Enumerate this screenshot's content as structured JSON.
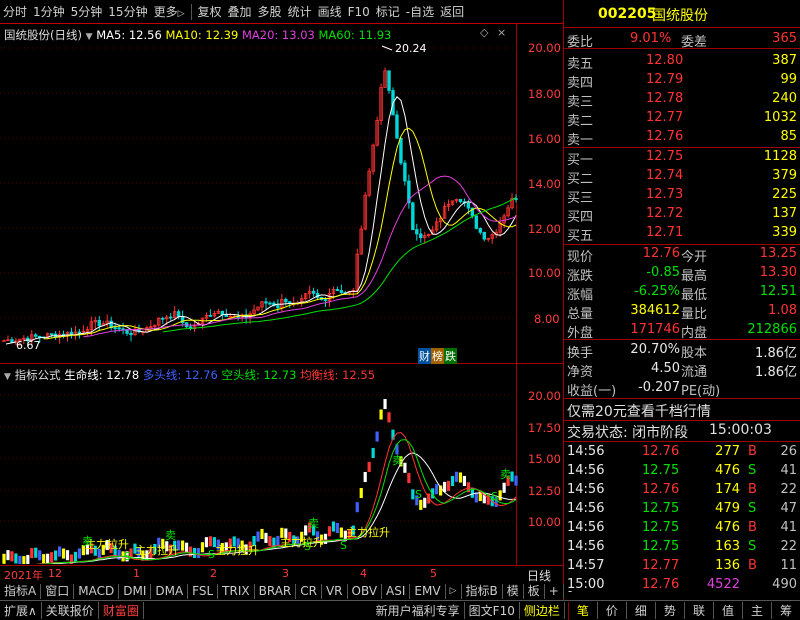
{
  "toolbar": {
    "items": [
      "分时",
      "1分钟",
      "5分钟",
      "15分钟",
      "更多",
      "复权",
      "叠加",
      "多股",
      "统计",
      "画线",
      "F10",
      "标记",
      "-自选",
      "返回"
    ],
    "more_arrow": "▷"
  },
  "stock": {
    "code": "002205",
    "name": "国统股份"
  },
  "main_chart": {
    "title": "国统股份(日线)",
    "ma5_label": "MA5: 12.56",
    "ma10_label": "MA10: 12.39",
    "ma20_label": "MA20: 13.03",
    "ma60_label": "MA60: 11.93",
    "high_label": "20.24",
    "low_label": "6.67",
    "price_ticks": [
      "20.00",
      "18.00",
      "16.00",
      "14.00",
      "12.00",
      "10.00",
      "8.00"
    ],
    "badges": [
      "财",
      "榜",
      "跌"
    ]
  },
  "indicator": {
    "title": "指标公式",
    "life_line": "生命线: 12.78",
    "long_line": "多头线: 12.76",
    "short_line": "空头线: 12.73",
    "balance_line": "均衡线: 12.55",
    "ticks": [
      "20.00",
      "17.50",
      "15.00",
      "12.50",
      "10.00"
    ],
    "annotations": [
      "主力拉升",
      "主力拉升",
      "主力拉升",
      "主力拉升",
      "主力拉升",
      "卖",
      "卖",
      "卖",
      "卖",
      "卖",
      "S",
      "S",
      "S",
      "S",
      "S",
      "S"
    ]
  },
  "date_axis": {
    "labels": [
      "2021年",
      "12",
      "1",
      "2",
      "3",
      "4",
      "5"
    ],
    "period": "日线"
  },
  "indicator_tabs": [
    "指标A",
    "窗口",
    "MACD",
    "DMI",
    "DMA",
    "FSL",
    "TRIX",
    "BRAR",
    "CR",
    "VR",
    "OBV",
    "ASI",
    "EMV"
  ],
  "indicator_tabs_right": [
    "指标B",
    "模",
    "板",
    "+",
    "-"
  ],
  "status_bar": {
    "left": [
      "扩展∧",
      "关联报价",
      "财富圈"
    ],
    "right": [
      "新用户福利专享",
      "图文F10",
      "侧边栏"
    ],
    "right_tabs": [
      "笔",
      "价",
      "细",
      "势",
      "联",
      "值",
      "主",
      "筹"
    ]
  },
  "quote": {
    "weibi_label": "委比",
    "weibi_value": "9.01%",
    "weicha_label": "委差",
    "weicha_value": "365",
    "asks": [
      {
        "label": "卖五",
        "price": "12.80",
        "vol": "387"
      },
      {
        "label": "卖四",
        "price": "12.79",
        "vol": "99"
      },
      {
        "label": "卖三",
        "price": "12.78",
        "vol": "240"
      },
      {
        "label": "卖二",
        "price": "12.77",
        "vol": "1032"
      },
      {
        "label": "卖一",
        "price": "12.76",
        "vol": "85"
      }
    ],
    "bids": [
      {
        "label": "买一",
        "price": "12.75",
        "vol": "1128"
      },
      {
        "label": "买二",
        "price": "12.74",
        "vol": "379"
      },
      {
        "label": "买三",
        "price": "12.73",
        "vol": "225"
      },
      {
        "label": "买四",
        "price": "12.72",
        "vol": "137"
      },
      {
        "label": "买五",
        "price": "12.71",
        "vol": "339"
      }
    ],
    "stats": [
      {
        "l1": "现价",
        "v1": "12.76",
        "l2": "今开",
        "v2": "13.25"
      },
      {
        "l1": "涨跌",
        "v1": "-0.85",
        "l2": "最高",
        "v2": "13.30"
      },
      {
        "l1": "涨幅",
        "v1": "-6.25%",
        "l2": "最低",
        "v2": "12.51"
      },
      {
        "l1": "总量",
        "v1": "384612",
        "l2": "量比",
        "v2": "1.08"
      },
      {
        "l1": "外盘",
        "v1": "171746",
        "l2": "内盘",
        "v2": "212866"
      }
    ],
    "stats2": [
      {
        "l1": "换手",
        "v1": "20.70%",
        "l2": "股本",
        "v2": "1.86亿"
      },
      {
        "l1": "净资",
        "v1": "4.50",
        "l2": "流通",
        "v2": "1.86亿"
      },
      {
        "l1": "收益(一)",
        "v1": "-0.207",
        "l2": "PE(动)",
        "v2": ""
      }
    ],
    "promo": "仅需20元查看千档行情",
    "trade_state_label": "交易状态: 闭市阶段",
    "trade_state_time": "15:00:03",
    "ticks": [
      {
        "t": "14:56",
        "p": "12.76",
        "v": "277",
        "bs": "B",
        "n": "26"
      },
      {
        "t": "14:56",
        "p": "12.75",
        "v": "476",
        "bs": "S",
        "n": "41"
      },
      {
        "t": "14:56",
        "p": "12.76",
        "v": "174",
        "bs": "B",
        "n": "22"
      },
      {
        "t": "14:56",
        "p": "12.75",
        "v": "479",
        "bs": "S",
        "n": "47"
      },
      {
        "t": "14:56",
        "p": "12.75",
        "v": "476",
        "bs": "B",
        "n": "41"
      },
      {
        "t": "14:56",
        "p": "12.75",
        "v": "163",
        "bs": "S",
        "n": "22"
      },
      {
        "t": "14:57",
        "p": "12.77",
        "v": "136",
        "bs": "B",
        "n": "11"
      },
      {
        "t": "15:00",
        "p": "12.76",
        "v": "4522",
        "bs": "",
        "n": "490"
      }
    ]
  },
  "colors": {
    "frame": "#a00000",
    "up": "#ff3333",
    "down": "#00e000",
    "ma5": "#ffffff",
    "ma10": "#ffff00",
    "ma20": "#e040e0",
    "ma60": "#00e000"
  }
}
